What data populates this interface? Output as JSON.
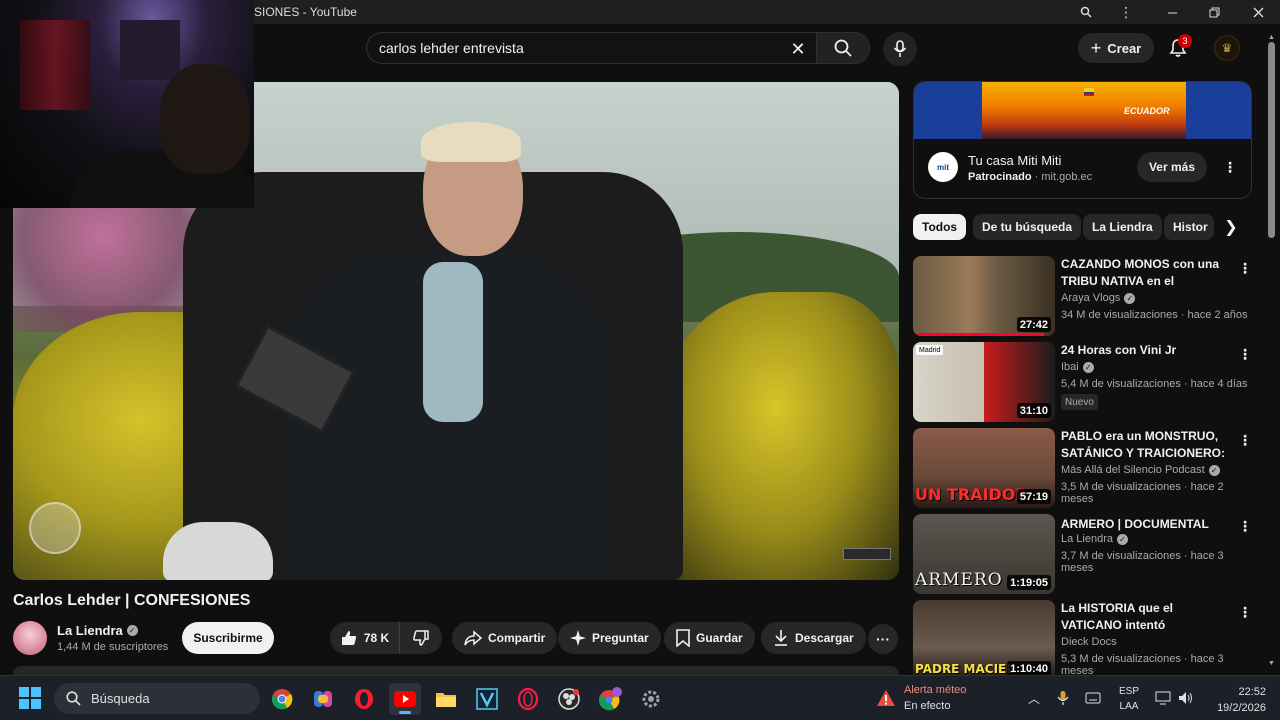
{
  "window": {
    "title": "SIONES - YouTube"
  },
  "search": {
    "query": "carlos lehder entrevista"
  },
  "header": {
    "create_label": "Crear",
    "notifications_count": "3"
  },
  "video": {
    "title": "Carlos Lehder | CONFESIONES",
    "channel": "La Liendra",
    "subscribers": "1,44 M de suscriptores",
    "subscribe_label": "Suscribirme",
    "likes": "78 K",
    "share_label": "Compartir",
    "ask_label": "Preguntar",
    "save_label": "Guardar",
    "download_label": "Descargar"
  },
  "ad": {
    "title": "Tu casa Miti Miti",
    "sponsored": "Patrocinado",
    "domain": "mit.gob.ec",
    "cta": "Ver más",
    "banner_text": "ECUADOR",
    "logo_text": "mit"
  },
  "chips": [
    "Todos",
    "De tu búsqueda",
    "La Liendra",
    "Histor"
  ],
  "related": [
    {
      "title": "CAZANDO MONOS con una TRIBU NATIVA en el CORAZÓ...",
      "channel": "Araya Vlogs",
      "verified": true,
      "meta": "34 M de visualizaciones · hace 2 años",
      "duration": "27:42",
      "watched": 0.92,
      "thumb_text": "",
      "thumb_tag": "",
      "badge": ""
    },
    {
      "title": "24 Horas con Vini Jr",
      "channel": "Ibai",
      "verified": true,
      "meta": "5,4 M de visualizaciones · hace 4 días",
      "duration": "31:10",
      "watched": 0,
      "thumb_text": "",
      "thumb_tag": "Madrid",
      "badge": "Nuevo"
    },
    {
      "title": "PABLO era un MONSTRUO, SATÁNICO Y TRAICIONERO: ...",
      "channel": "Más Allá del Silencio Podcast",
      "verified": true,
      "meta": "3,5 M de visualizaciones · hace 2 meses",
      "duration": "57:19",
      "watched": 0,
      "thumb_text": "UN TRAIDOR",
      "thumb_tag": "",
      "badge": ""
    },
    {
      "title": "ARMERO | DOCUMENTAL",
      "channel": "La Liendra",
      "verified": true,
      "meta": "3,7 M de visualizaciones · hace 3 meses",
      "duration": "1:19:05",
      "watched": 0,
      "thumb_text": "ARMERO",
      "thumb_tag": "",
      "badge": ""
    },
    {
      "title": "La HISTORIA que el VATICANO intentó ENTERRAR | Padre ...",
      "channel": "Dieck Docs",
      "verified": false,
      "meta": "5,3 M de visualizaciones · hace 3 meses",
      "duration": "1:10:40",
      "watched": 0,
      "thumb_text": "PADRE MACIEL",
      "thumb_tag": "",
      "badge": ""
    }
  ],
  "taskbar": {
    "search_placeholder": "Búsqueda",
    "alert_title": "Alerta méteo",
    "alert_status": "En efecto",
    "lang_1": "ESP",
    "lang_2": "LAA",
    "time": "22:52",
    "date": "19/2/2026"
  },
  "colors": {
    "accent": "#ff0033",
    "background": "#0f0f0f",
    "chip_active": "#f1f1f1"
  }
}
